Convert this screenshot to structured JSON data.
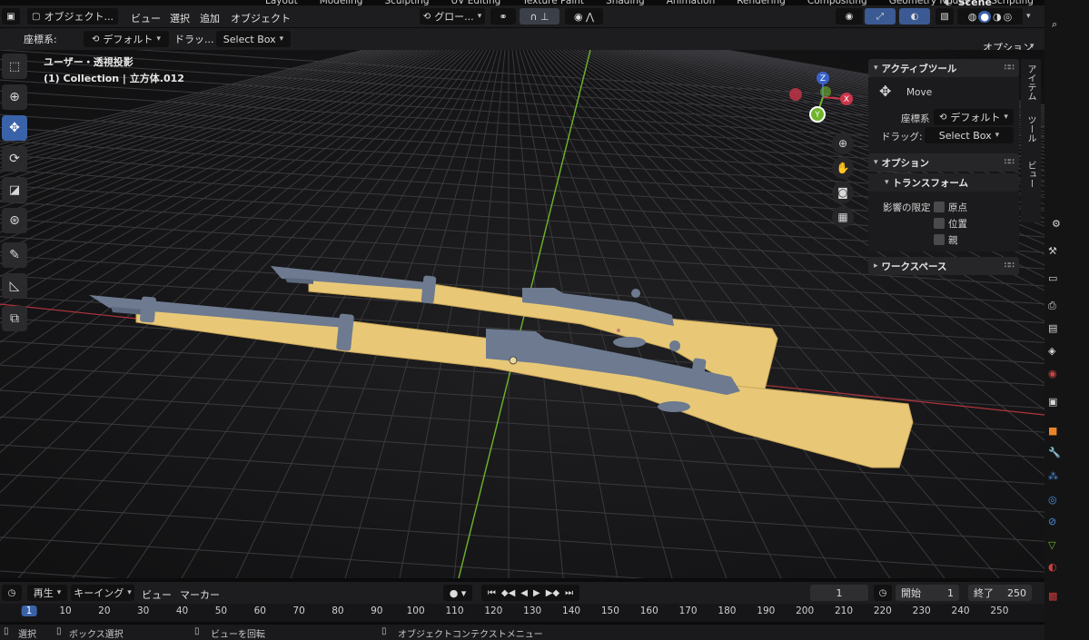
{
  "workspace_tabs": [
    "Layout",
    "Modeling",
    "Sculpting",
    "UV Editing",
    "Texture Paint",
    "Shading",
    "Animation",
    "Rendering",
    "Compositing",
    "Geometry Nodes",
    "Scripting"
  ],
  "scene_name": "Scene",
  "header": {
    "mode": "オブジェクト...",
    "menus": [
      "ビュー",
      "選択",
      "追加",
      "オブジェクト"
    ],
    "transform_orientation": "グロー...",
    "options_label": "オプション"
  },
  "tool_header": {
    "coord_label": "座標系:",
    "coord_value": "デフォルト",
    "drag_label": "ドラッ...",
    "drag_value": "Select Box"
  },
  "viewport": {
    "view_name": "ユーザー・透視投影",
    "collection_info": "(1) Collection | 立方体.012",
    "gizmo": {
      "z_label": "Z",
      "y_label": "Y",
      "x_label": "X"
    }
  },
  "npanel": {
    "active_tool_title": "アクティブツール",
    "tool_name": "Move",
    "coord_label": "座標系",
    "coord_value": "デフォルト",
    "drag_label": "ドラッグ:",
    "drag_value": "Select Box",
    "options_title": "オプション",
    "transform_title": "トランスフォーム",
    "affect_only_label": "影響の限定",
    "affect_items": [
      "原点",
      "位置",
      "親"
    ],
    "workspace_title": "ワークスペース",
    "side_tabs": [
      "アイテム",
      "ツール",
      "ビュー"
    ]
  },
  "timeline": {
    "playback_label": "再生",
    "keying_label": "キーイング",
    "view_label": "ビュー",
    "marker_label": "マーカー",
    "current_frame": "1",
    "start_label": "開始",
    "start_value": "1",
    "end_label": "終了",
    "end_value": "250",
    "ruler_ticks": [
      "1",
      "10",
      "20",
      "30",
      "40",
      "50",
      "60",
      "70",
      "80",
      "90",
      "100",
      "110",
      "120",
      "130",
      "140",
      "150",
      "160",
      "170",
      "180",
      "190",
      "200",
      "210",
      "220",
      "230",
      "240",
      "250"
    ]
  },
  "statusbar": {
    "select": "選択",
    "box_select": "ボックス選択",
    "rotate_view": "ビューを回転",
    "context_menu": "オブジェクトコンテクストメニュー"
  },
  "colors": {
    "accent_blue": "#3a62a8",
    "stock_wood": "#e8c877",
    "metal": "#6d7a90",
    "grid_line": "#3a3a3e",
    "axis_green": "#6fb52a",
    "axis_red": "#b0343c"
  }
}
